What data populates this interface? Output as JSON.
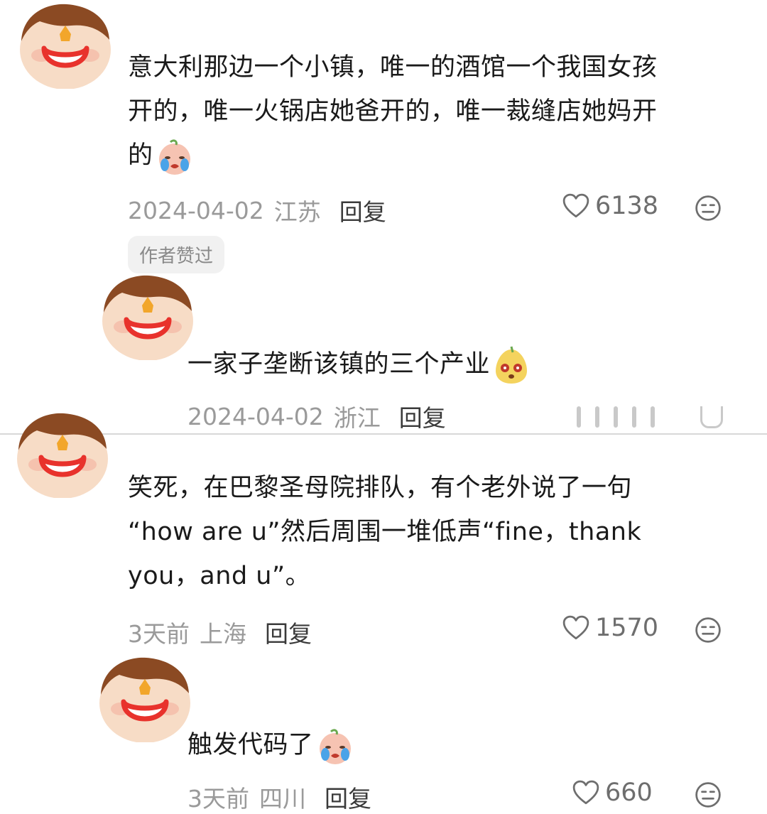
{
  "comments": [
    {
      "text_lines": [
        "意大利那边一个小镇，唯一的酒馆一个我国女孩",
        "开的，唯一火锅店她爸开的，唯一裁缝店她妈开",
        "的"
      ],
      "date": "2024-04-02",
      "location": "江苏",
      "reply_label": "回复",
      "likes": "6138",
      "badge": "作者赞过",
      "emoji": "crying-peach-emoji"
    },
    {
      "text": "一家子垄断该镇的三个产业",
      "date": "2024-04-02",
      "location": "浙江",
      "reply_label": "回复",
      "emoji": "pear-face-emoji"
    },
    {
      "text_lines": [
        "笑死，在巴黎圣母院排队，有个老外说了一句",
        "“how are u”然后周围一堆低声“fine，thank",
        "you，and u”。"
      ],
      "date": "3天前",
      "location": "上海",
      "reply_label": "回复",
      "likes": "1570"
    },
    {
      "text": "触发代码了",
      "date": "3天前",
      "location": "四川",
      "reply_label": "回复",
      "likes": "660",
      "emoji": "crying-peach-emoji"
    }
  ],
  "colors": {
    "avatar_hair": "#8b4a23",
    "avatar_face": "#f7dcc6",
    "avatar_mouth": "#e8322c",
    "avatar_nose": "#f2a62b"
  }
}
